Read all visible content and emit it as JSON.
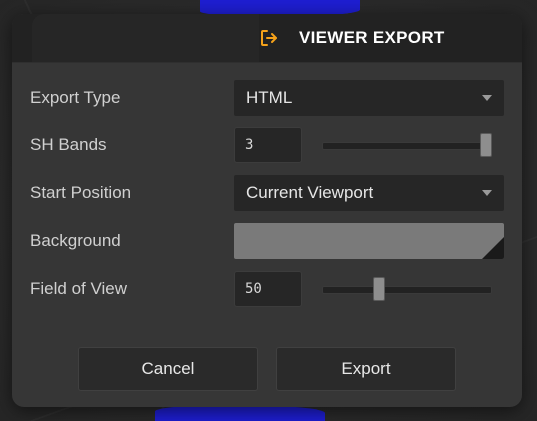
{
  "dialog": {
    "title": "VIEWER EXPORT",
    "icon": "export-icon",
    "accent_color": "#f5a21a"
  },
  "fields": {
    "export_type": {
      "label": "Export Type",
      "value": "HTML"
    },
    "sh_bands": {
      "label": "SH Bands",
      "value": "3",
      "min": 0,
      "max": 3,
      "level": 1.0
    },
    "start_position": {
      "label": "Start Position",
      "value": "Current Viewport"
    },
    "background": {
      "label": "Background",
      "color": "#7a7a7a"
    },
    "field_of_view": {
      "label": "Field of View",
      "value": "50",
      "level": 0.32
    }
  },
  "buttons": {
    "cancel": "Cancel",
    "export": "Export"
  }
}
